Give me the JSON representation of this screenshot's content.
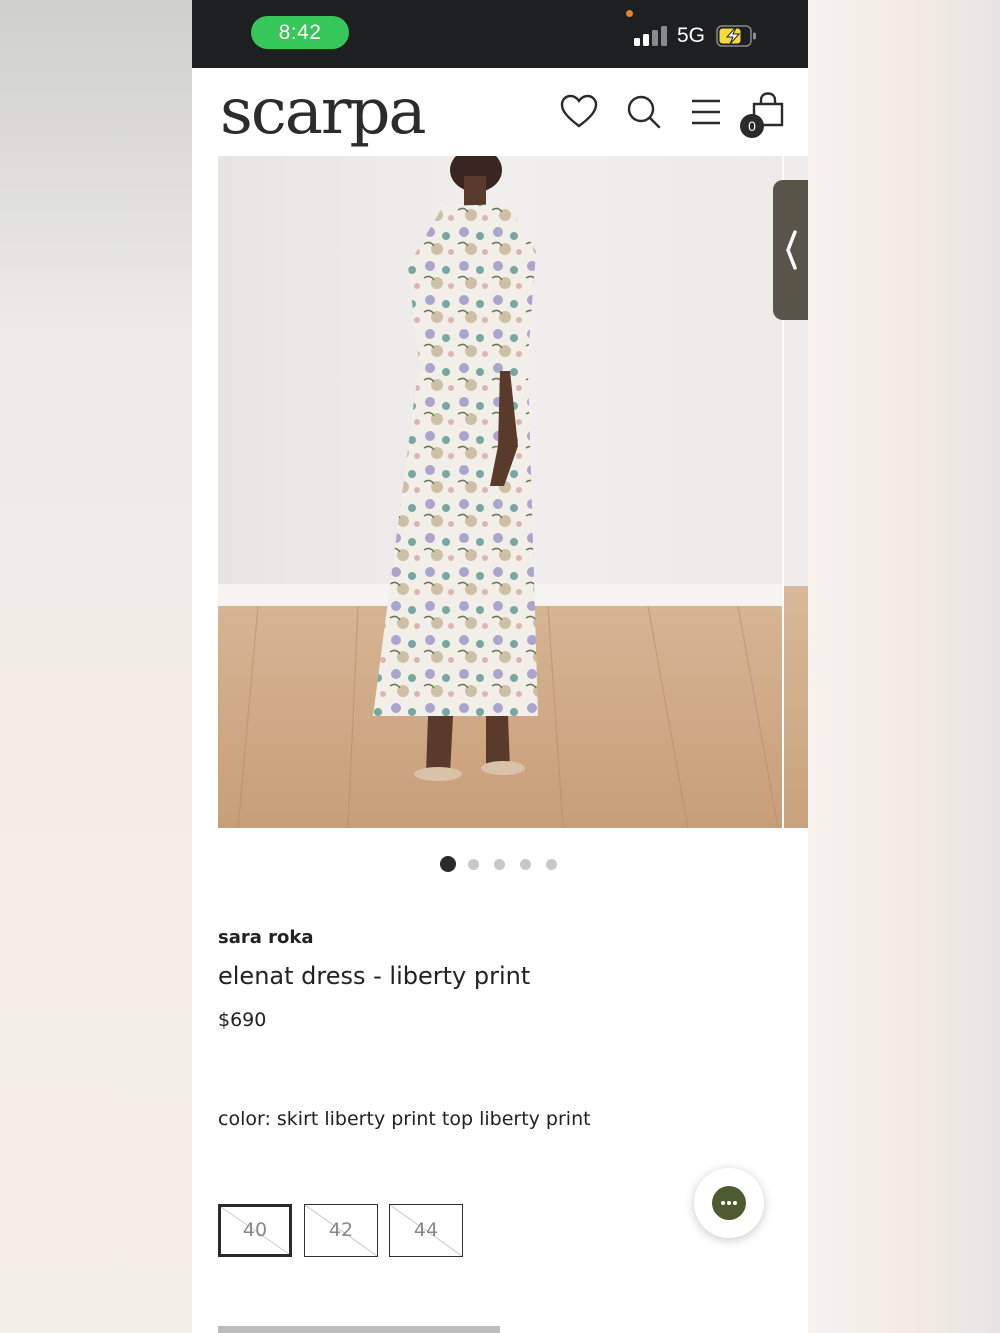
{
  "status_bar": {
    "time": "8:42",
    "network": "5G",
    "colors": {
      "time_pill": "#35c759",
      "battery": "#f7d93c"
    }
  },
  "header": {
    "logo": "scarpa",
    "icons": [
      "heart-icon",
      "search-icon",
      "menu-icon",
      "shopping-bag-icon"
    ],
    "cart_count": "0"
  },
  "gallery": {
    "image_description_icon": "product-photo",
    "slide_count": 5,
    "active_slide": 1
  },
  "product": {
    "brand": "sara roka",
    "title": "elenat dress - liberty print",
    "price": "$690",
    "color_line": "color: skirt liberty print top liberty print",
    "sizes": [
      {
        "label": "40",
        "selected": true,
        "unavailable": true
      },
      {
        "label": "42",
        "selected": false,
        "unavailable": true
      },
      {
        "label": "44",
        "selected": false,
        "unavailable": true
      }
    ]
  },
  "chat": {
    "icon": "chat-bubble-icon",
    "accent": "#4e5a30"
  }
}
